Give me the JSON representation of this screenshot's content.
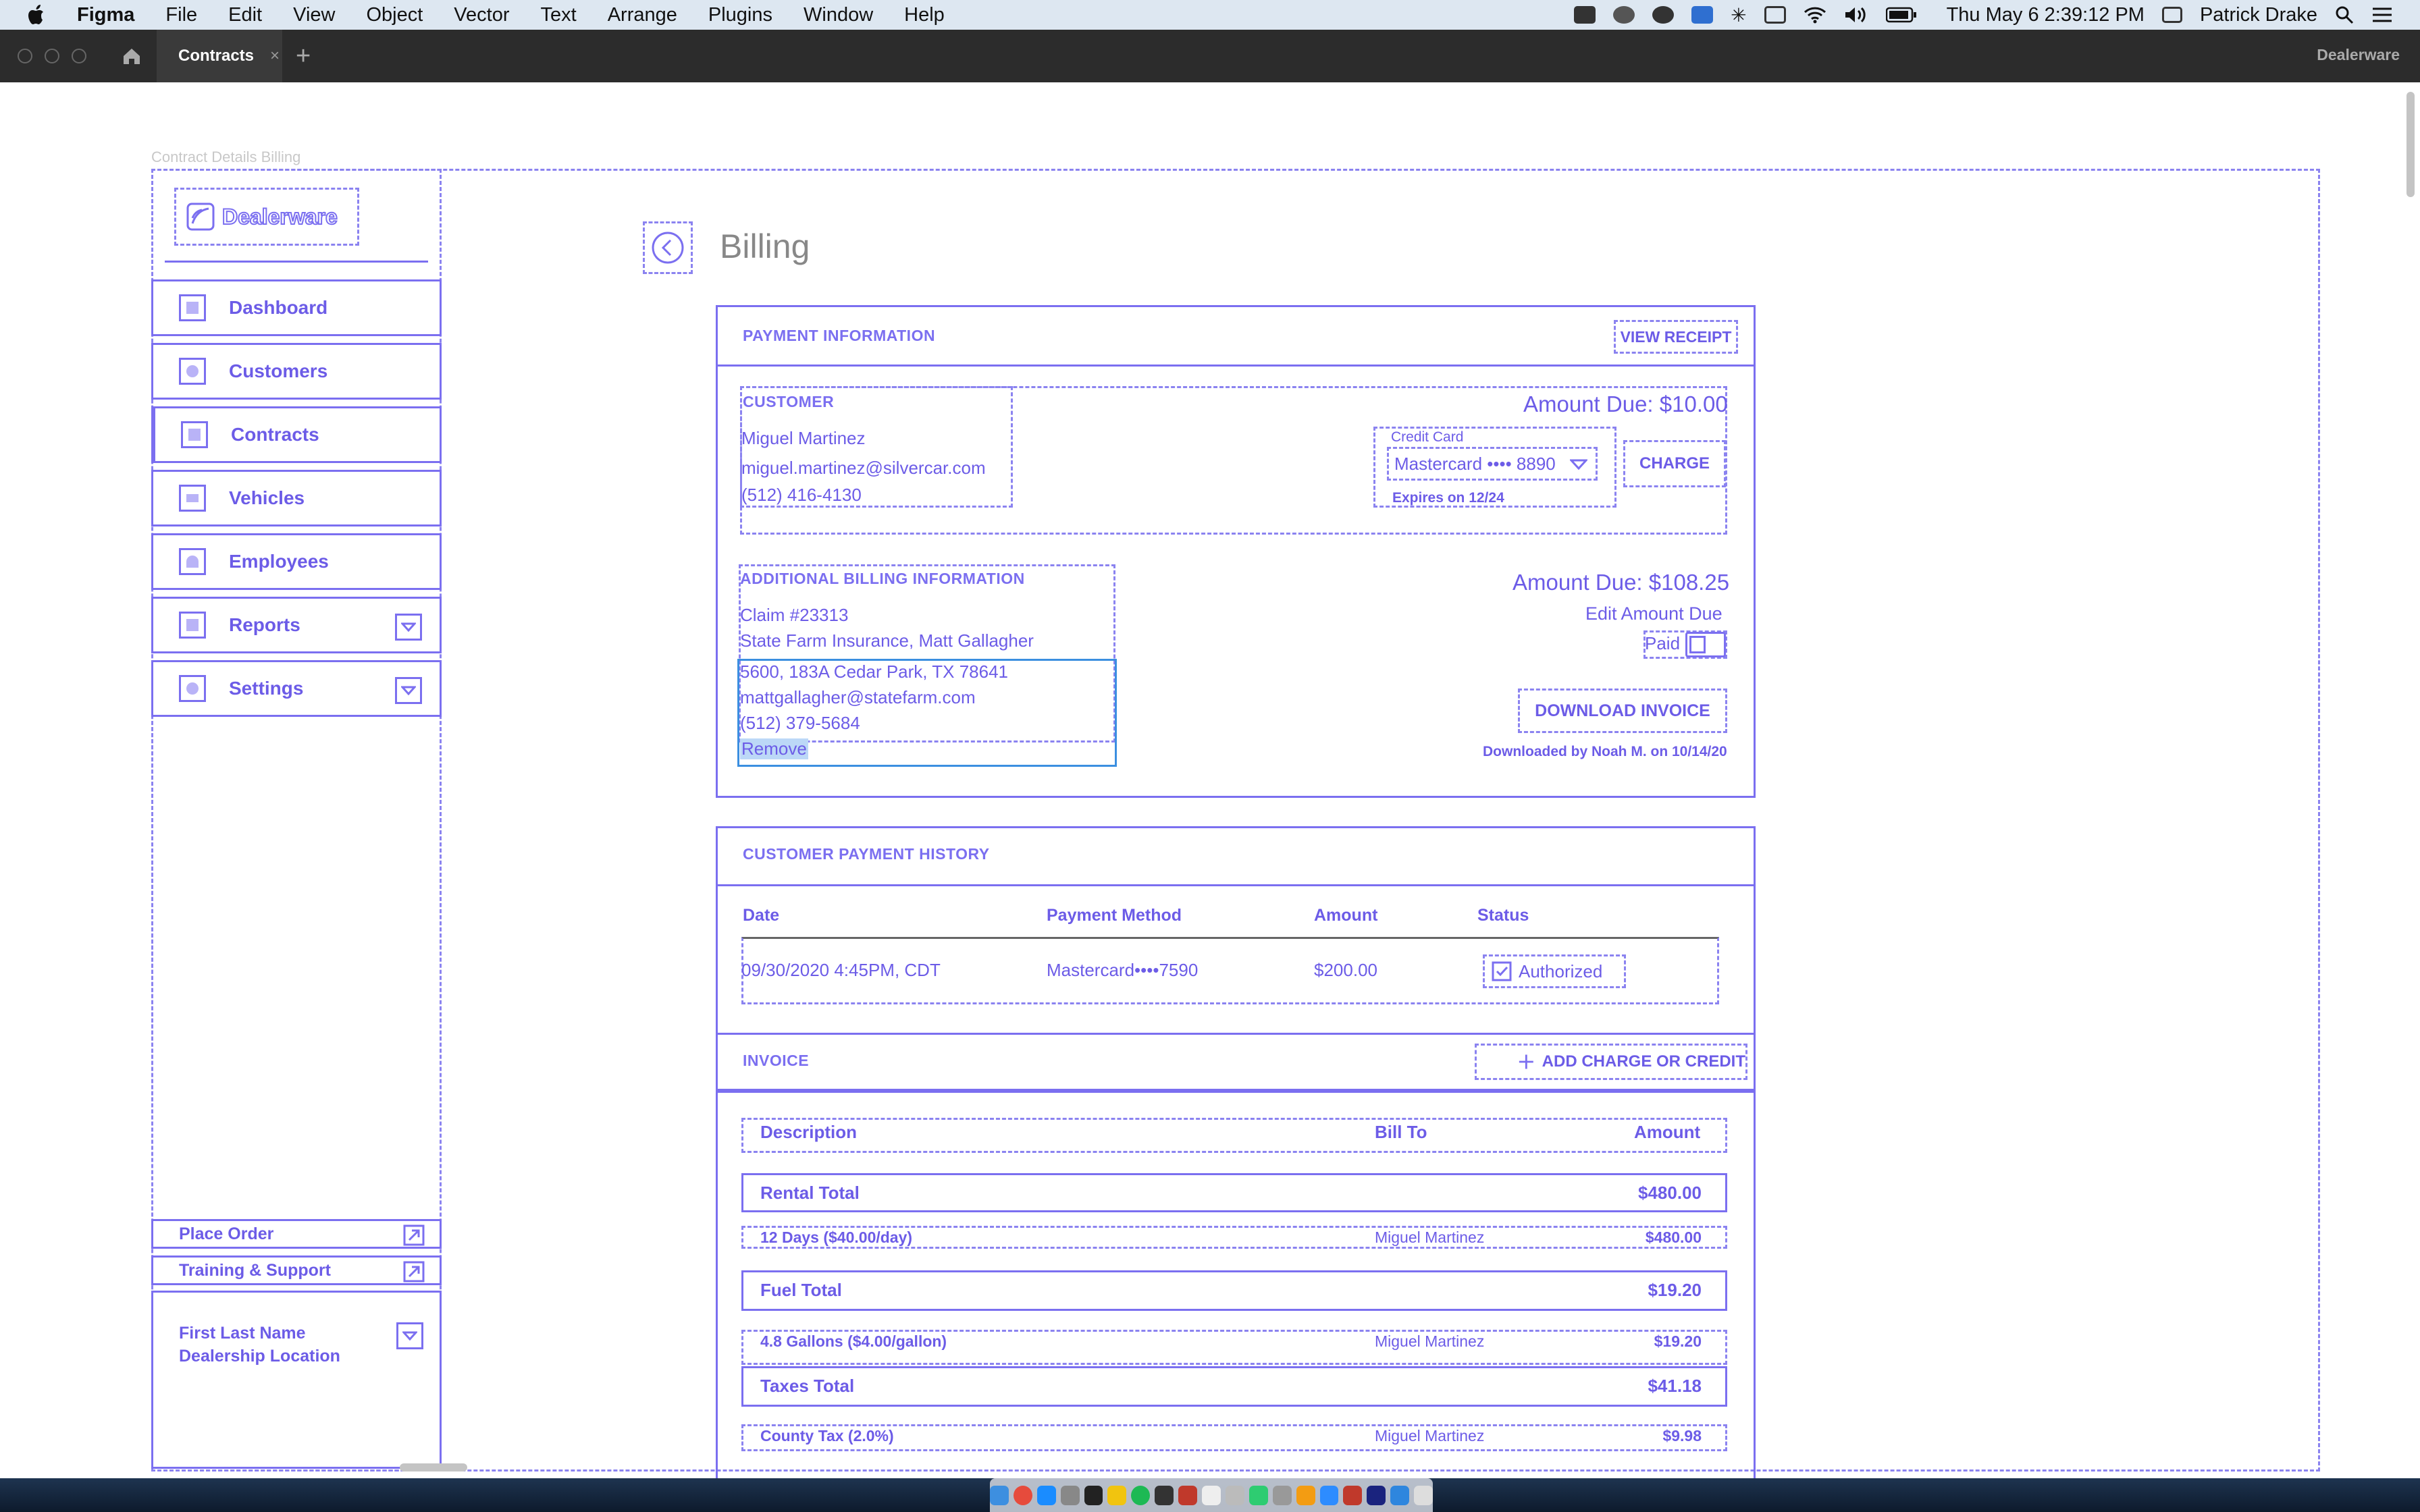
{
  "menubar": {
    "app": "Figma",
    "items": [
      "File",
      "Edit",
      "View",
      "Object",
      "Vector",
      "Text",
      "Arrange",
      "Plugins",
      "Window",
      "Help"
    ],
    "clock": "Thu May 6  2:39:12 PM",
    "user": "Patrick Drake"
  },
  "tabbar": {
    "active_tab": "Contracts",
    "close_glyph": "×",
    "new_tab_glyph": "+",
    "app_label": "Dealerware"
  },
  "frame_label": "Contract Details Billing",
  "logo": "Dealerware",
  "sidebar": {
    "items": [
      {
        "label": "Dashboard"
      },
      {
        "label": "Customers"
      },
      {
        "label": "Contracts"
      },
      {
        "label": "Vehicles"
      },
      {
        "label": "Employees"
      },
      {
        "label": "Reports"
      },
      {
        "label": "Settings"
      }
    ],
    "bottom_links": [
      "Place Order",
      "Training & Support"
    ],
    "account": {
      "name": "First Last Name",
      "location": "Dealership Location"
    }
  },
  "page": {
    "title": "Billing"
  },
  "payment_info": {
    "title": "PAYMENT INFORMATION",
    "view_receipt": "VIEW RECEIPT",
    "customer": {
      "label": "CUSTOMER",
      "name": "Miguel Martinez",
      "email": "miguel.martinez@silvercar.com",
      "phone": "(512) 416-4130"
    },
    "amount_due": "Amount Due: $10.00",
    "credit_card_label": "Credit Card",
    "card_value": "Mastercard •••• 8890",
    "expires": "Expires on 12/24",
    "charge": "CHARGE"
  },
  "additional_billing": {
    "title": "ADDITIONAL BILLING INFORMATION",
    "claim": "Claim #23313",
    "insurer": "State Farm Insurance, Matt Gallagher",
    "address": "5600, 183A  Cedar Park, TX 78641",
    "email": "mattgallagher@statefarm.com",
    "phone": "(512) 379-5684",
    "remove": "Remove",
    "amount_due": "Amount Due: $108.25",
    "edit_amount": "Edit Amount Due",
    "paid": "Paid",
    "download_invoice": "DOWNLOAD INVOICE",
    "downloaded_note": "Downloaded by Noah M. on 10/14/20"
  },
  "history": {
    "title": "CUSTOMER PAYMENT HISTORY",
    "headers": [
      "Date",
      "Payment Method",
      "Amount",
      "Status"
    ],
    "rows": [
      {
        "date": "09/30/2020 4:45PM, CDT",
        "method": "Mastercard••••7590",
        "amount": "$200.00",
        "status": "Authorized"
      }
    ]
  },
  "invoice": {
    "title": "INVOICE",
    "add_button": "ADD CHARGE OR CREDIT",
    "headers": {
      "description": "Description",
      "bill_to": "Bill To",
      "amount": "Amount"
    },
    "rows": [
      {
        "kind": "total",
        "description": "Rental Total",
        "bill_to": "",
        "amount": "$480.00"
      },
      {
        "kind": "line",
        "description": "12 Days ($40.00/day)",
        "bill_to": "Miguel Martinez",
        "amount": "$480.00"
      },
      {
        "kind": "total",
        "description": "Fuel Total",
        "bill_to": "",
        "amount": "$19.20"
      },
      {
        "kind": "line",
        "description": "4.8 Gallons ($4.00/gallon)",
        "bill_to": "Miguel Martinez",
        "amount": "$19.20"
      },
      {
        "kind": "total",
        "description": "Taxes Total",
        "bill_to": "",
        "amount": "$41.18"
      },
      {
        "kind": "line",
        "description": "County Tax (2.0%)",
        "bill_to": "Miguel Martinez",
        "amount": "$9.98"
      }
    ]
  },
  "colors": {
    "accent": "#6c5ce7",
    "outline": "#7b6ff0",
    "menubar": "#dde7f1",
    "tabbar": "#2c2c2c"
  }
}
